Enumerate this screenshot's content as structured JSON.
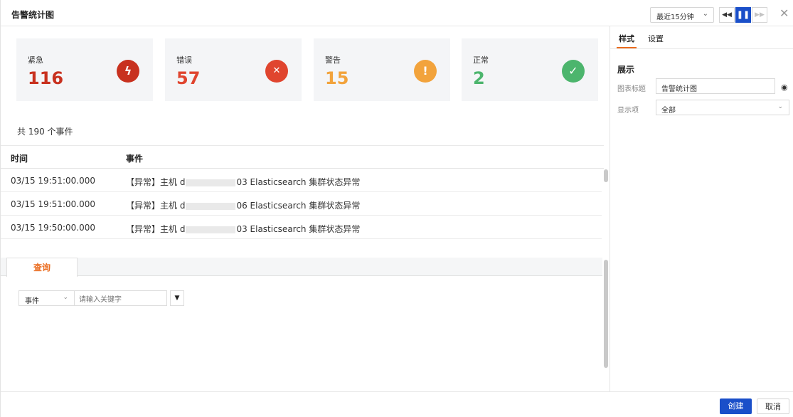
{
  "window": {
    "title": "告警统计图"
  },
  "toolbar": {
    "time_range": "最近15分钟",
    "rewind_icon": "◀◀",
    "pause_icon": "❚❚",
    "forward_icon": "▶▶",
    "close_icon": "✕"
  },
  "cards": [
    {
      "label": "紧急",
      "value": "116",
      "color": "#c8311f",
      "icon": "lightning-icon",
      "glyph": "ϟ"
    },
    {
      "label": "错误",
      "value": "57",
      "color": "#e0452f",
      "icon": "x-circle-icon",
      "glyph": "✕"
    },
    {
      "label": "警告",
      "value": "15",
      "color": "#f2a33c",
      "icon": "exclamation-icon",
      "glyph": "!"
    },
    {
      "label": "正常",
      "value": "2",
      "color": "#4cb56d",
      "icon": "check-icon",
      "glyph": "✓"
    }
  ],
  "events": {
    "count_label": "共 190 个事件",
    "columns": [
      "时间",
      "事件"
    ],
    "rows": [
      {
        "time": "03/15 19:51:00.000",
        "pre": "【异常】主机 d",
        "post": "03 Elasticsearch 集群状态异常"
      },
      {
        "time": "03/15 19:51:00.000",
        "pre": "【异常】主机 d",
        "post": "06 Elasticsearch 集群状态异常"
      },
      {
        "time": "03/15 19:50:00.000",
        "pre": "【异常】主机 d",
        "post": "03 Elasticsearch 集群状态异常"
      }
    ]
  },
  "query": {
    "tab_label": "查询",
    "field_select": "事件",
    "placeholder": "请输入关键字",
    "filter_icon": "▼"
  },
  "panel": {
    "tabs": [
      "样式",
      "设置"
    ],
    "section_title": "展示",
    "chart_title_label": "图表标题",
    "chart_title_value": "告警统计图",
    "eye_icon": "◉",
    "display_label": "显示项",
    "display_value": "全部"
  },
  "footer": {
    "create": "创建",
    "cancel": "取消"
  },
  "accent_color": "#ea6b1e",
  "primary_color": "#1a4fc9"
}
